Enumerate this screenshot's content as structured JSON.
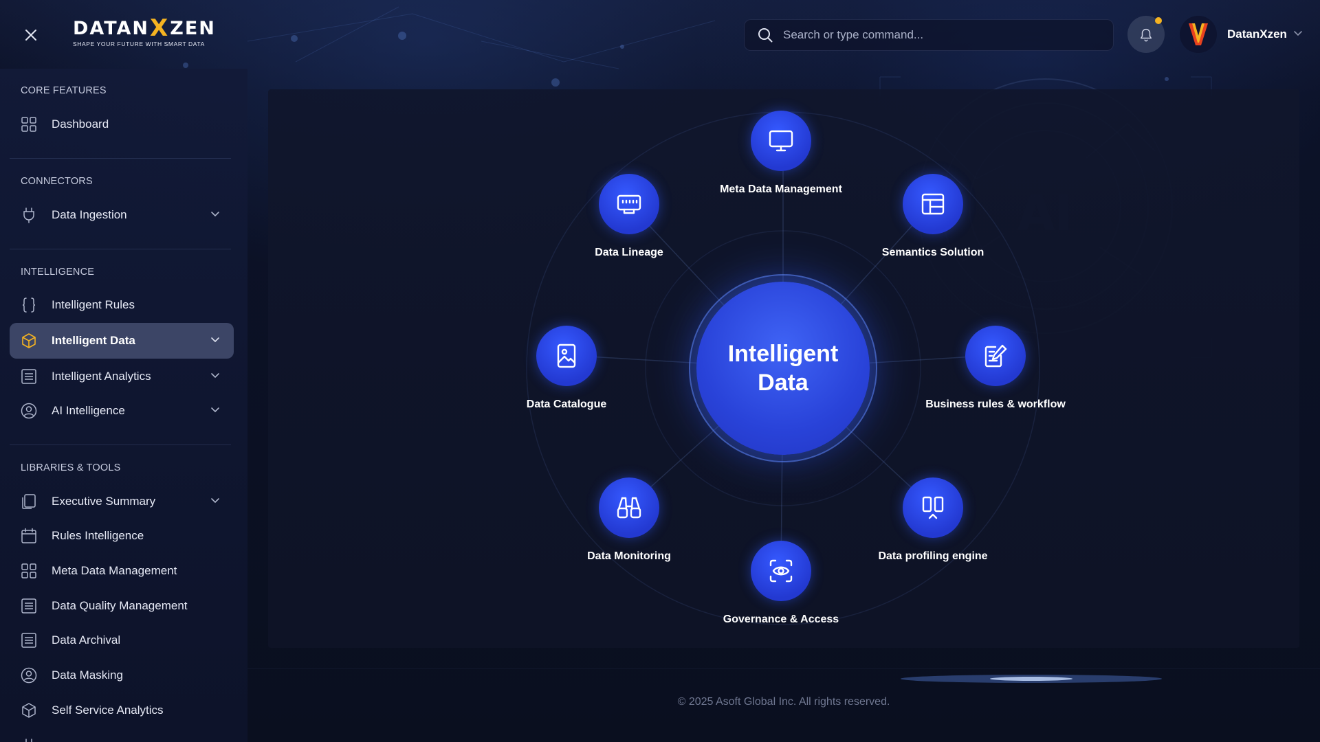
{
  "app": {
    "logo_word_a": "DATAN",
    "logo_word_x": "X",
    "logo_word_b": "ZEN",
    "tagline": "SHAPE YOUR FUTURE WITH SMART DATA"
  },
  "header": {
    "search_placeholder": "Search or type command...",
    "user_name": "DatanXzen"
  },
  "sidebar": {
    "sections": [
      {
        "title": "CORE FEATURES",
        "items": [
          {
            "label": "Dashboard",
            "icon": "grid-icon"
          }
        ]
      },
      {
        "title": "CONNECTORS",
        "items": [
          {
            "label": "Data Ingestion",
            "icon": "plug-icon",
            "chevron": true
          }
        ]
      },
      {
        "title": "INTELLIGENCE",
        "items": [
          {
            "label": "Intelligent Rules",
            "icon": "braces-icon"
          },
          {
            "label": "Intelligent Data",
            "icon": "cube-icon",
            "chevron": true,
            "active": true
          },
          {
            "label": "Intelligent Analytics",
            "icon": "list-icon",
            "chevron": true
          },
          {
            "label": "AI Intelligence",
            "icon": "user-circle-icon",
            "chevron": true
          }
        ]
      },
      {
        "title": "LIBRARIES & TOOLS",
        "items": [
          {
            "label": "Executive Summary",
            "icon": "copy-icon",
            "chevron": true
          },
          {
            "label": "Rules Intelligence",
            "icon": "calendar-icon"
          },
          {
            "label": "Meta Data Management",
            "icon": "grid-icon"
          },
          {
            "label": "Data Quality Management",
            "icon": "list-icon"
          },
          {
            "label": "Data Archival",
            "icon": "list-icon"
          },
          {
            "label": "Data Masking",
            "icon": "user-circle-icon"
          },
          {
            "label": "Self Service Analytics",
            "icon": "cube-icon"
          }
        ]
      }
    ]
  },
  "hub": {
    "center_line1": "Intelligent",
    "center_line2": "Data",
    "nodes": [
      {
        "label": "Meta Data Management",
        "icon": "monitor-icon"
      },
      {
        "label": "Semantics Solution",
        "icon": "layout-icon"
      },
      {
        "label": "Business rules & workflow",
        "icon": "edit-note-icon"
      },
      {
        "label": "Data profiling engine",
        "icon": "columns-icon"
      },
      {
        "label": "Governance & Access",
        "icon": "eye-scan-icon"
      },
      {
        "label": "Data Monitoring",
        "icon": "binoculars-icon"
      },
      {
        "label": "Data Catalogue",
        "icon": "image-icon"
      },
      {
        "label": "Data Lineage",
        "icon": "ethernet-icon"
      }
    ]
  },
  "footer": {
    "copyright": "© 2025 Asoft Global Inc. All rights reserved."
  },
  "colors": {
    "accent": "#2d4ff0",
    "logo_x": "#f5b321",
    "notification_dot": "#f5b321",
    "sidebar_active_icon": "#f5b321"
  }
}
